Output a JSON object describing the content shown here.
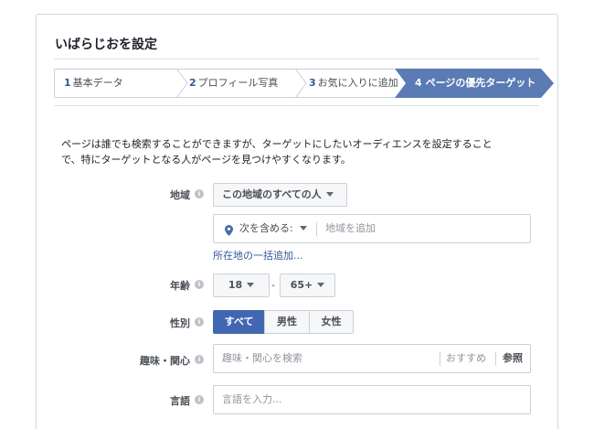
{
  "dialog": {
    "title": "いばらじおを設定"
  },
  "steps": [
    {
      "num": "1",
      "label": "基本データ",
      "active": false
    },
    {
      "num": "2",
      "label": "プロフィール写真",
      "active": false
    },
    {
      "num": "3",
      "label": "お気に入りに追加",
      "active": false
    },
    {
      "num": "4",
      "label": "ページの優先ターゲット",
      "active": true
    }
  ],
  "intro": {
    "line1": "ページは誰でも検索することができますが、ターゲットにしたいオーディエンスを設定すること",
    "line2": "で、特にターゲットとなる人がページを見つけやすくなります。"
  },
  "location": {
    "label": "地域",
    "dropdown_value": "この地域のすべての人",
    "include_label": "次を含める:",
    "placeholder": "地域を追加",
    "bulk_link": "所在地の一括追加..."
  },
  "age": {
    "label": "年齢",
    "min": "18",
    "separator": "-",
    "max": "65+"
  },
  "gender": {
    "label": "性別",
    "options": [
      "すべて",
      "男性",
      "女性"
    ],
    "selected": "すべて"
  },
  "interests": {
    "label": "趣味・関心",
    "placeholder": "趣味・関心を検索",
    "suggestions": "おすすめ",
    "browse": "参照"
  },
  "language": {
    "label": "言語",
    "placeholder": "言語を入力..."
  },
  "colors": {
    "accent": "#4267b2",
    "active_step": "#5b7bb5",
    "link": "#365899",
    "border": "#ccd0d5"
  }
}
